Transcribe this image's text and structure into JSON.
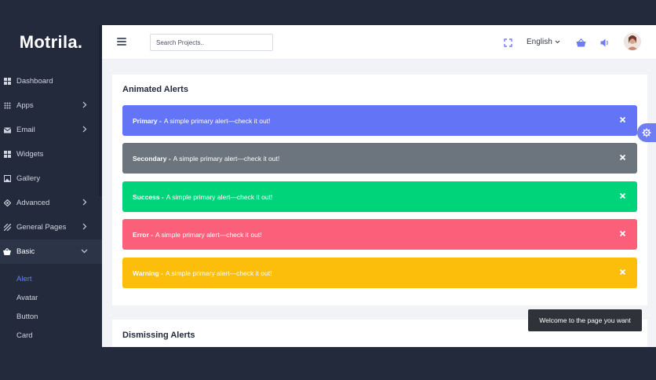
{
  "brand": "Motrila.",
  "sidebar": {
    "items": [
      {
        "label": "Dashboard",
        "icon": "dashboard-icon",
        "arrow": false
      },
      {
        "label": "Apps",
        "icon": "apps-icon",
        "arrow": true
      },
      {
        "label": "Email",
        "icon": "email-icon",
        "arrow": true
      },
      {
        "label": "Widgets",
        "icon": "widgets-icon",
        "arrow": false
      },
      {
        "label": "Gallery",
        "icon": "gallery-icon",
        "arrow": false
      },
      {
        "label": "Advanced",
        "icon": "advanced-icon",
        "arrow": true
      },
      {
        "label": "General Pages",
        "icon": "pages-icon",
        "arrow": true
      },
      {
        "label": "Basic",
        "icon": "basic-icon",
        "arrow": true,
        "active": true
      }
    ],
    "subitems": [
      {
        "label": "Alert",
        "active": true
      },
      {
        "label": "Avatar"
      },
      {
        "label": "Button"
      },
      {
        "label": "Card"
      }
    ]
  },
  "header": {
    "search_placeholder": "Search Projects..",
    "language": "English"
  },
  "card1": {
    "title": "Animated Alerts",
    "alerts": [
      {
        "strong": "Primary -",
        "text": "A simple primary alert—check it out!",
        "color": "#6474f7"
      },
      {
        "strong": "Secondary -",
        "text": "A simple primary alert—check it out!",
        "color": "#6c757d"
      },
      {
        "strong": "Success -",
        "text": "A simple primary alert—check it out!",
        "color": "#00d47a"
      },
      {
        "strong": "Error -",
        "text": "A simple primary alert—check it out!",
        "color": "#fc5f7a"
      },
      {
        "strong": "Warning -",
        "text": "A simple primary alert—check it out!",
        "color": "#fcbe0b"
      }
    ]
  },
  "card2": {
    "title": "Dismissing Alerts"
  },
  "toast": "Welcome to the page you want",
  "colors": {
    "accent": "#6f7df5",
    "sidebar_bg": "#232a3b"
  }
}
